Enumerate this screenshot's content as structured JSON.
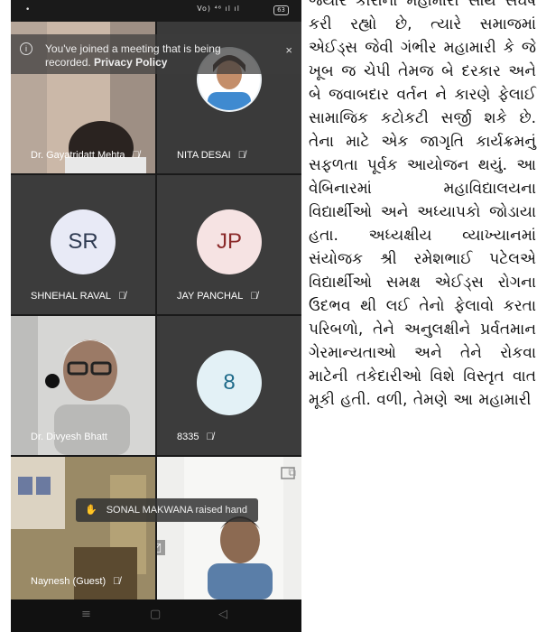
{
  "status_bar": {
    "left_dot": "•",
    "network": "Vo) ⁴⁶ ıl ıl",
    "battery": "63"
  },
  "banner": {
    "message": "You've joined a meeting that is being recorded.",
    "link": "Privacy Policy",
    "close": "×"
  },
  "participants": [
    {
      "name": "Dr. Gayatridatt Mehta",
      "type": "video"
    },
    {
      "name": "NITA DESAI",
      "type": "photo"
    },
    {
      "name": "SHNEHAL RAVAL",
      "type": "initials",
      "initials": "SR",
      "avatar_color": "#e8eaf6",
      "initials_color": "#2f3b52"
    },
    {
      "name": "JAY PANCHAL",
      "type": "initials",
      "initials": "JP",
      "avatar_color": "#f6e3e3",
      "initials_color": "#8b2a2a"
    },
    {
      "name": "Dr. Divyesh Bhatt",
      "type": "video"
    },
    {
      "name": "8335",
      "type": "initials",
      "initials": "8",
      "avatar_color": "#e3f1f6",
      "initials_color": "#1f6b8a"
    },
    {
      "name": "Naynesh (Guest)",
      "type": "video"
    },
    {
      "name": "",
      "type": "video"
    }
  ],
  "raised_hand": {
    "text": "SONAL MAKWANA raised hand"
  },
  "nav": {
    "menu": "≡",
    "home": "▢",
    "back": "◁"
  },
  "article": {
    "text": "જ્યારે કોરોના મહામારી સાથે સંઘર્ષ કરી રહ્યો છે, ત્યારે સમાજમાં એઈડ્સ જેવી ગંભીર મહામારી કે જે ખૂબ જ ચેપી તેમજ બે દરકાર અને બે જવાબદાર વર્તન ને કારણે ફેલાઈ સામાજિક કટોકટી સર્જી શકે છે. તેના માટે એક જાગૃતિ કાર્યક્રમનું સફળતા પૂર્વક આયોજન થયું. આ વેબિનારમાં મહાવિદ્યાલયના વિદ્યાર્થીઓ અને અધ્યાપકો જોડાયા હતા. અધ્યક્ષીય વ્યાખ્યાનમાં સંયોજક શ્રી રમેશભાઈ પટેલએ વિદ્યાર્થીઓ સમક્ષ એઈડ્સ રોગના ઉદભવ થી લઈ તેનો ફેલાવો કરતા પરિબળો, તેને અનુલક્ષીને પ્રર્વતમાન ગેરમાન્યતાઓ અને તેને રોકવા માટેની તકેદારીઓ વિશે વિસ્તૃત વાત મૂકી હતી. વળી, તેમણે આ મહામારી"
  }
}
